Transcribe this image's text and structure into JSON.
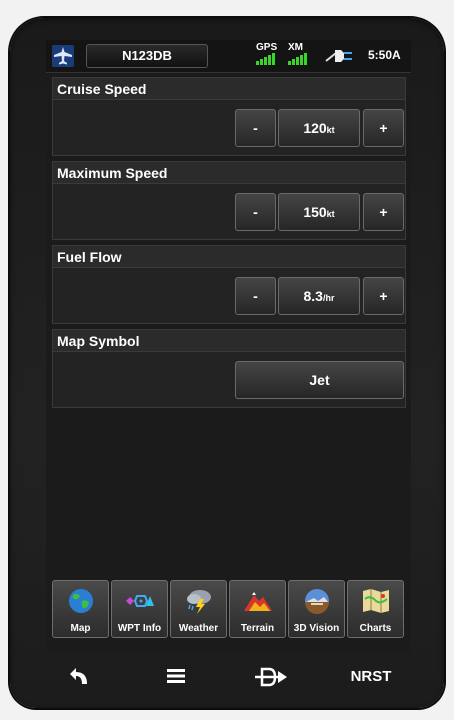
{
  "status_bar": {
    "tail_number": "N123DB",
    "gps_label": "GPS",
    "xm_label": "XM",
    "clock": "5:50A",
    "signal_color": "#39d42e"
  },
  "sections": [
    {
      "title": "Cruise Speed",
      "minus": "-",
      "value": "120",
      "unit": "kt",
      "plus": "+"
    },
    {
      "title": "Maximum Speed",
      "minus": "-",
      "value": "150",
      "unit": "kt",
      "plus": "+"
    },
    {
      "title": "Fuel Flow",
      "minus": "-",
      "value": "8.3",
      "unit": "/hr",
      "plus": "+"
    },
    {
      "title": "Map Symbol",
      "value": "Jet"
    }
  ],
  "tiles": [
    {
      "label": "Map",
      "icon": "globe-icon"
    },
    {
      "label": "WPT Info",
      "icon": "waypoint-symbols-icon"
    },
    {
      "label": "Weather",
      "icon": "storm-cloud-icon"
    },
    {
      "label": "Terrain",
      "icon": "mountain-icon"
    },
    {
      "label": "3D Vision",
      "icon": "synthetic-vision-icon"
    },
    {
      "label": "Charts",
      "icon": "chart-map-icon"
    }
  ],
  "nav": {
    "back_icon": "back-arrow-icon",
    "menu_icon": "menu-icon",
    "direct_to_icon": "direct-to-icon",
    "nrst_label": "NRST"
  }
}
